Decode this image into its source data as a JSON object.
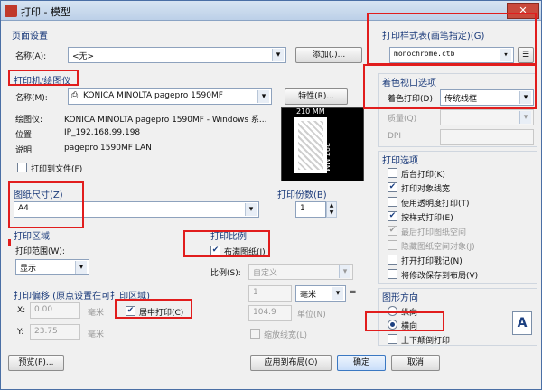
{
  "window": {
    "title": "打印 - 模型",
    "close_label": "✕"
  },
  "page_setup": {
    "group_label": "页面设置",
    "name_label": "名称(A):",
    "name_value": "<无>",
    "add_button": "添加(.)..."
  },
  "printer": {
    "group_label": "打印机/绘图仪",
    "name_label": "名称(M):",
    "name_value": "KONICA MINOLTA pagepro 1590MF",
    "properties_button": "特性(R)...",
    "plotter_label": "绘图仪:",
    "plotter_value": "KONICA MINOLTA pagepro 1590MF - Windows 系...",
    "location_label": "位置:",
    "location_value": "IP_192.168.99.198",
    "description_label": "说明:",
    "description_value": "pagepro 1590MF LAN",
    "print_to_file_label": "打印到文件(F)",
    "print_to_file_checked": false,
    "preview_width_label": "210 MM",
    "preview_height_label": "297 MM"
  },
  "paper_size": {
    "group_label": "图纸尺寸(Z)",
    "value": "A4"
  },
  "copies": {
    "label": "打印份数(B)",
    "value": "1"
  },
  "plot_area": {
    "group_label": "打印区域",
    "range_label": "打印范围(W):",
    "range_value": "显示"
  },
  "plot_scale": {
    "group_label": "打印比例",
    "fit_label": "布满图纸(I)",
    "fit_checked": true,
    "scale_label": "比例(S):",
    "scale_value": "自定义",
    "value1": "1",
    "unit_value": "毫米",
    "equals": "=",
    "value2": "104.9",
    "unit_label": "单位(N)",
    "lineweights_label": "缩放线宽(L)"
  },
  "plot_offset": {
    "group_label": "打印偏移 (原点设置在可打印区域)",
    "x_label": "X:",
    "x_value": "0.00",
    "x_unit": "毫米",
    "y_label": "Y:",
    "y_value": "23.75",
    "y_unit": "毫米",
    "center_label": "居中打印(C)",
    "center_checked": true
  },
  "plot_style_table": {
    "group_label": "打印样式表(画笔指定)(G)",
    "value": "monochrome.ctb"
  },
  "shaded_viewport": {
    "group_label": "着色视口选项",
    "shade_label": "着色打印(D)",
    "shade_value": "传统线框",
    "quality_label": "质量(Q)",
    "dpi_label": "DPI"
  },
  "plot_options": {
    "group_label": "打印选项",
    "items": [
      {
        "label": "后台打印(K)",
        "checked": false,
        "disabled": false
      },
      {
        "label": "打印对象线宽",
        "checked": true,
        "disabled": false
      },
      {
        "label": "使用透明度打印(T)",
        "checked": false,
        "disabled": false
      },
      {
        "label": "按样式打印(E)",
        "checked": true,
        "disabled": false
      },
      {
        "label": "最后打印图纸空间",
        "checked": true,
        "disabled": true
      },
      {
        "label": "隐藏图纸空间对象(J)",
        "checked": false,
        "disabled": true
      },
      {
        "label": "打开打印戳记(N)",
        "checked": false,
        "disabled": false
      },
      {
        "label": "将修改保存到布局(V)",
        "checked": false,
        "disabled": false
      }
    ]
  },
  "orientation": {
    "group_label": "图形方向",
    "portrait_label": "纵向",
    "landscape_label": "横向",
    "upside_down_label": "上下颠倒打印",
    "selected": "landscape",
    "icon_letter": "A"
  },
  "footer": {
    "preview_button": "预览(P)...",
    "apply_button": "应用到布局(O)",
    "ok_button": "确定",
    "cancel_button": "取消"
  },
  "colors": {
    "highlight": "#e11d1d",
    "group_text": "#1a3a7a",
    "accent": "#3b78c2"
  }
}
